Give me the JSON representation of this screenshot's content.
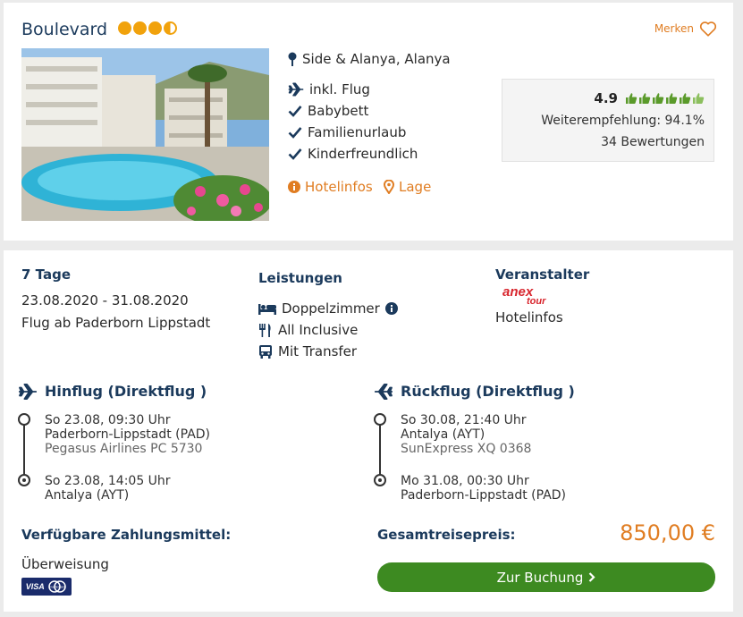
{
  "hotel": {
    "name": "Boulevard",
    "stars": 3.5,
    "merken_label": "Merken",
    "location": "Side & Alanya, Alanya",
    "features": [
      "inkl. Flug",
      "Babybett",
      "Familienurlaub",
      "Kinderfreundlich"
    ],
    "links": {
      "hotelinfos": "Hotelinfos",
      "lage": "Lage"
    },
    "rating": {
      "value": "4.9",
      "thumbs": 6,
      "recommendation": "Weiterempfehlung: 94.1%",
      "reviews": "34 Bewertungen"
    }
  },
  "offer": {
    "duration": "7 Tage",
    "dates": "23.08.2020 - 31.08.2020",
    "departure": "Flug ab Paderborn Lippstadt",
    "services_title": "Leistungen",
    "services": [
      "Doppelzimmer",
      "All Inclusive",
      "Mit Transfer"
    ],
    "operator_title": "Veranstalter",
    "operator_logo": {
      "line1": "anex",
      "line2": "tour"
    },
    "operator_link": "Hotelinfos"
  },
  "outbound": {
    "title": "Hinflug (Direktflug )",
    "dep_time": "So 23.08, 09:30 Uhr",
    "dep_airport": "Paderborn-Lippstadt (PAD)",
    "airline": "Pegasus Airlines PC 5730",
    "arr_time": "So 23.08, 14:05 Uhr",
    "arr_airport": "Antalya (AYT)"
  },
  "return": {
    "title": "Rückflug (Direktflug )",
    "dep_time": "So 30.08, 21:40 Uhr",
    "dep_airport": "Antalya (AYT)",
    "airline": "SunExpress XQ 0368",
    "arr_time": "Mo 31.08, 00:30 Uhr",
    "arr_airport": "Paderborn-Lippstadt (PAD)"
  },
  "payment": {
    "title": "Verfügbare Zahlungsmittel:",
    "method": "Überweisung",
    "card_labels": {
      "visa": "VISA",
      "mastercard": "mastercard"
    }
  },
  "total": {
    "label": "Gesamtreisepreis:",
    "price": "850,00 €",
    "button": "Zur Buchung"
  },
  "colors": {
    "accent": "#e07d22",
    "navy": "#1b3a5c",
    "button_green": "#3d8a21",
    "star": "#f1a20c",
    "thumb": "#5a9a2a"
  }
}
